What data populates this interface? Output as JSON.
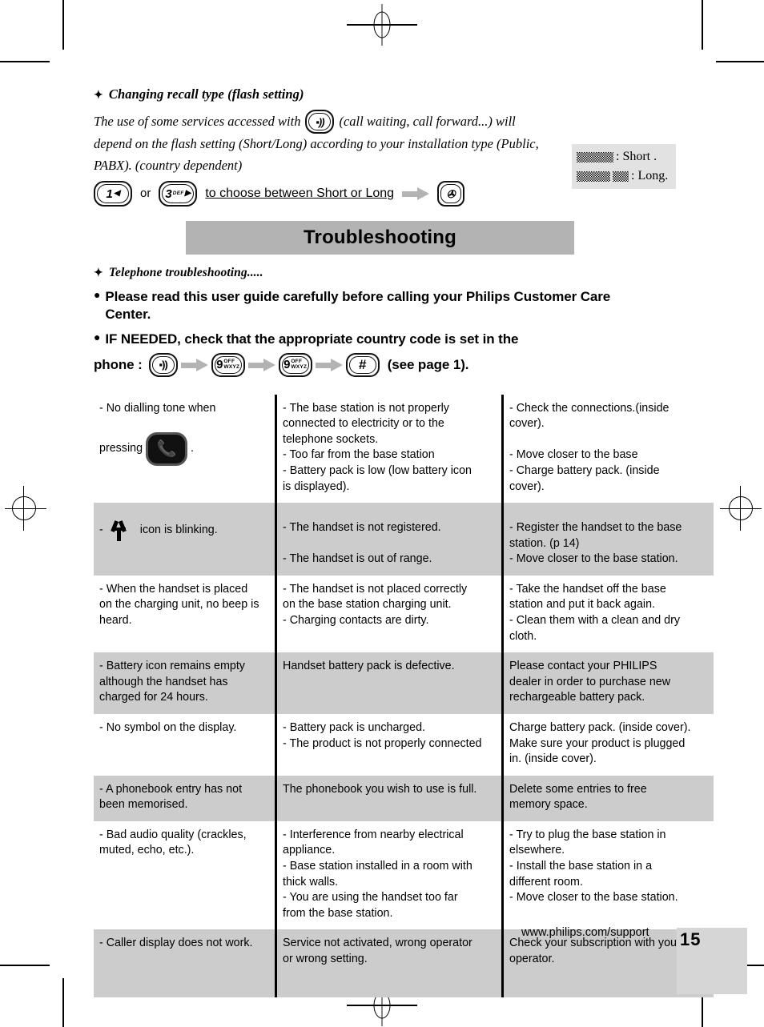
{
  "section1": {
    "heading": "Changing recall type (flash setting)",
    "diamond": "✦",
    "intro_line1_a": "The use of some services accessed with",
    "intro_line1_b": "(call waiting, call forward...) will",
    "intro_line2": "depend on the flash setting (Short/Long) according to your installation type (Public,",
    "intro_line3": "PABX). (country dependent)",
    "step_or": "or",
    "step_instruction": "to choose between Short or Long",
    "key_1_label": "1",
    "key_1_arrow": "◀",
    "key_3_label": "3",
    "key_3_sub": "DEF",
    "key_3_arrow": "▶",
    "recall_key_label": "R"
  },
  "legend": {
    "row1_text": ": Short .",
    "row2_text": ": Long.",
    "row1_icon": "dithered-short-bar",
    "row2_icon": "dithered-long-bar"
  },
  "banner": {
    "title": "Troubleshooting"
  },
  "notices": {
    "diamond_heading": "Telephone troubleshooting.....",
    "bullet": "●",
    "notice1": "Please read this user guide carefully before calling your Philips Customer Care Center.",
    "notice2": "IF NEEDED, check that the appropriate country code is set in the",
    "notice3_prefix": "phone :",
    "notice3_suffix": "(see page 1).",
    "seq_key1": "R",
    "seq_key2_digit": "9",
    "seq_key2_off": "OFF",
    "seq_key2_letters": "WXYZ",
    "seq_key3_digit": "9",
    "seq_key3_off": "OFF",
    "seq_key3_letters": "WXYZ",
    "seq_key4": "#"
  },
  "table": {
    "rows": [
      {
        "shaded": false,
        "problem_pre": "- No dialling tone when",
        "problem_mid": "pressing",
        "problem_icon": "talk-key-icon",
        "problem_post": ".",
        "causes": [
          "- The base station is not properly",
          "connected to electricity or to the",
          "telephone sockets.",
          "- Too far from the base station",
          "- Battery pack is low (low battery icon",
          "is displayed)."
        ],
        "solutions": [
          "- Check the connections.(inside",
          "cover).",
          "",
          "- Move closer to the base",
          "- Charge battery pack. (inside",
          "cover)."
        ]
      },
      {
        "shaded": true,
        "problem_pre": "-",
        "problem_icon": "antenna-icon",
        "problem_post": "icon is blinking.",
        "causes": [
          "- The handset is not registered.",
          "",
          "- The handset is out of range."
        ],
        "solutions": [
          "- Register the handset to the base",
          "station. (p 14)",
          "- Move closer to the base station."
        ]
      },
      {
        "shaded": false,
        "problem_lines": [
          "- When the handset is placed",
          "on the charging unit, no beep is",
          "heard."
        ],
        "causes": [
          "- The handset is not placed correctly",
          "on the base station charging unit.",
          "-  Charging contacts are dirty."
        ],
        "solutions": [
          "- Take the handset off the base",
          "station and put it back again.",
          "- Clean them with a clean and dry",
          "cloth."
        ]
      },
      {
        "shaded": true,
        "problem_lines": [
          "- Battery icon remains empty",
          "although the handset has",
          "charged for 24 hours."
        ],
        "causes": [
          "Handset battery pack is defective."
        ],
        "solutions": [
          "Please contact your PHILIPS",
          "dealer in order to purchase new",
          "rechargeable battery pack."
        ]
      },
      {
        "shaded": false,
        "problem_lines": [
          "- No symbol on the display."
        ],
        "causes": [
          "- Battery pack is uncharged.",
          "- The product is not properly connected"
        ],
        "solutions": [
          "Charge battery pack. (inside cover).",
          "Make sure your product is plugged",
          "in. (inside cover)."
        ]
      },
      {
        "shaded": true,
        "problem_lines": [
          "- A phonebook entry has not",
          "been memorised."
        ],
        "causes": [
          "The phonebook you wish to use is full."
        ],
        "solutions": [
          "Delete some entries to free",
          "memory space."
        ]
      },
      {
        "shaded": false,
        "problem_lines": [
          "- Bad audio quality (crackles,",
          "muted, echo, etc.)."
        ],
        "causes": [
          "- Interference from nearby electrical",
          "appliance.",
          "- Base station installed in a room with",
          "thick walls.",
          "- You are using the handset too far",
          "from the base station."
        ],
        "solutions": [
          "- Try to plug the base station in",
          "elsewhere.",
          "- Install the base station in a",
          "different room.",
          "- Move closer to the base station."
        ]
      },
      {
        "shaded": true,
        "problem_lines": [
          "- Caller display does not work."
        ],
        "causes": [
          "Service not activated, wrong operator",
          "or wrong setting."
        ],
        "solutions": [
          "Check your subscription with your",
          "operator."
        ]
      }
    ]
  },
  "footer": {
    "url": "www.philips.com/support",
    "page_number": "15"
  }
}
